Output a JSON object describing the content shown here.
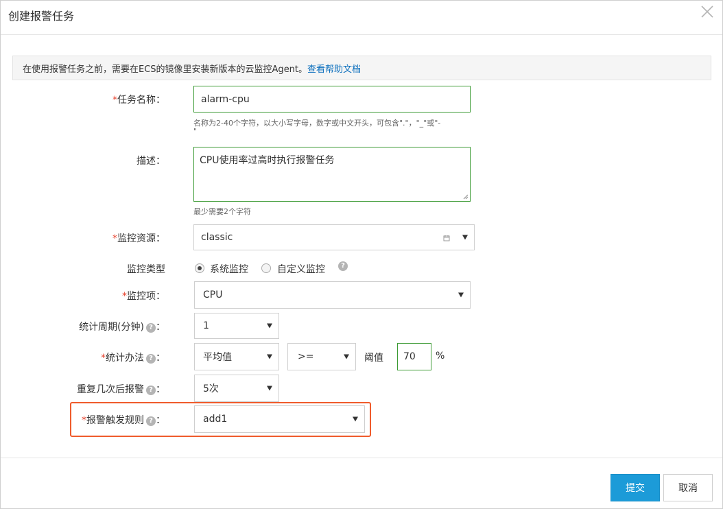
{
  "dialog": {
    "title": "创建报警任务",
    "close_icon": "close-icon"
  },
  "notice": {
    "text": "在使用报警任务之前，需要在ECS的镜像里安装新版本的云监控Agent。",
    "link": "查看帮助文档"
  },
  "form": {
    "task_name": {
      "label": "任务名称：",
      "value": "alarm-cpu",
      "hint_line1": "名称为2-40个字符，以大小写字母，数字或中文开头，可包含\".\"，\"_\"或\"-",
      "hint_line2": "\""
    },
    "description": {
      "label": "描述：",
      "value": "CPU使用率过高时执行报警任务",
      "hint": "最少需要2个字符"
    },
    "resource": {
      "label": "监控资源：",
      "value": "classic",
      "icon": "calendar-icon"
    },
    "monitor_type": {
      "label": "监控类型",
      "option1": "系统监控",
      "option2": "自定义监控",
      "selected": "系统监控"
    },
    "metric": {
      "label": "监控项：",
      "value": "CPU"
    },
    "period": {
      "label_text": "统计周期(分钟)",
      "colon": "：",
      "value": "1"
    },
    "method": {
      "label_text": "统计办法",
      "colon": "：",
      "value": "平均值",
      "operator": ">=",
      "threshold_label": "阈值",
      "threshold": "70",
      "unit": "%"
    },
    "repeat": {
      "label_text": "重复几次后报警",
      "colon": "：",
      "value": "5次"
    },
    "trigger_rule": {
      "label_text": "报警触发规则",
      "colon": "：",
      "value": "add1"
    }
  },
  "buttons": {
    "submit": "提交",
    "cancel": "取消"
  },
  "colors": {
    "accent": "#1c9bd8",
    "required": "#e6412c",
    "valid_border": "#3d9b35",
    "highlight": "#ef5b2c"
  }
}
